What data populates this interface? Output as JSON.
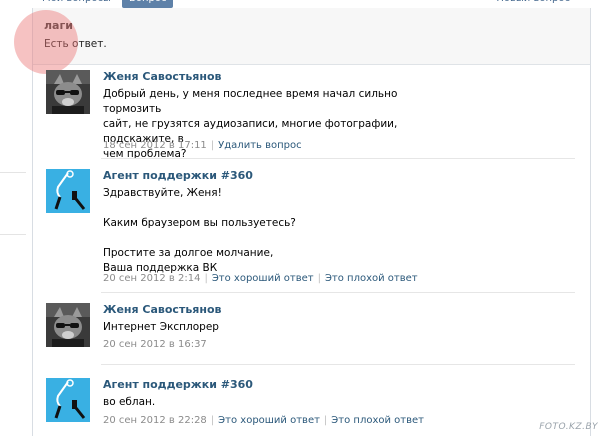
{
  "tabs": {
    "my_questions": "Мои вопросы",
    "question": "Вопрос",
    "new_question": "Новый вопрос"
  },
  "question": {
    "title": "лаги",
    "status": "Есть ответ."
  },
  "posts": [
    {
      "author": "Женя Савостьянов",
      "lines": [
        "Добрый день, у меня последнее время начал сильно тормозить",
        "сайт, не грузятся аудиозаписи, многие фотографии, подскажите, в",
        "чем проблема?"
      ],
      "date": "18 сен 2012 в 17:11",
      "action": "Удалить вопрос"
    },
    {
      "author": "Агент поддержки #360",
      "lines": [
        "Здравствуйте, Женя!",
        "",
        "Каким браузером вы пользуетесь?",
        "",
        "Простите за долгое молчание,",
        "Ваша поддержка ВК"
      ],
      "date": "20 сен 2012 в 2:14",
      "good": "Это хороший ответ",
      "bad": "Это плохой ответ"
    },
    {
      "author": "Женя Савостьянов",
      "lines": [
        "Интернет Эксплорер"
      ],
      "date": "20 сен 2012 в 16:37"
    },
    {
      "author": "Агент поддержки #360",
      "lines": [
        "во еблан."
      ],
      "date": "20 сен 2012 в 22:28",
      "good": "Это хороший ответ",
      "bad": "Это плохой ответ"
    }
  ],
  "watermark": "FOTO.KZ.BY",
  "colors": {
    "link": "#2b587a",
    "tab_active": "#5e81a8",
    "meta": "#8b8b8b",
    "agent_avatar": "#39b0e3"
  }
}
